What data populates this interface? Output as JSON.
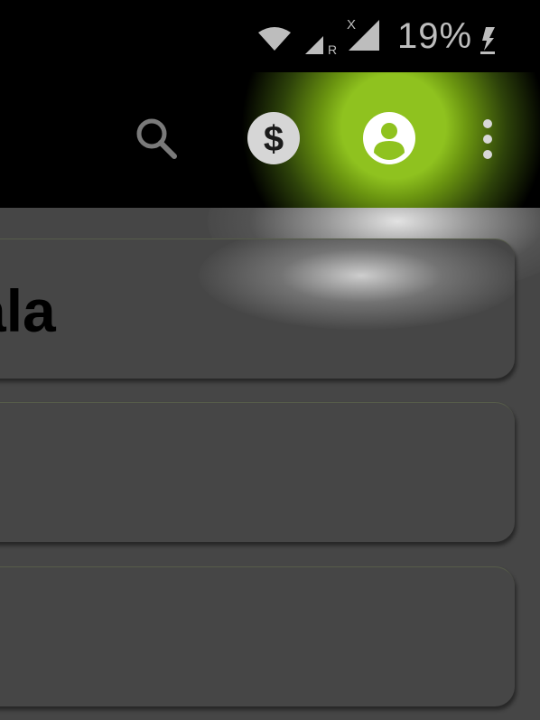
{
  "status_bar": {
    "battery_percent": "19%",
    "signal_badge_1": "R",
    "signal_badge_2": "X",
    "icons": [
      "wifi-icon",
      "signal-roaming-icon",
      "signal-no-service-icon",
      "charging-bolt-icon"
    ]
  },
  "toolbar": {
    "icons": [
      "search-icon",
      "dollar-icon",
      "account-icon",
      "more-vert-icon"
    ],
    "highlight_color": "#8fc21f"
  },
  "cards": [
    {
      "title": "ala"
    },
    {
      "title": ""
    },
    {
      "title": ""
    }
  ]
}
